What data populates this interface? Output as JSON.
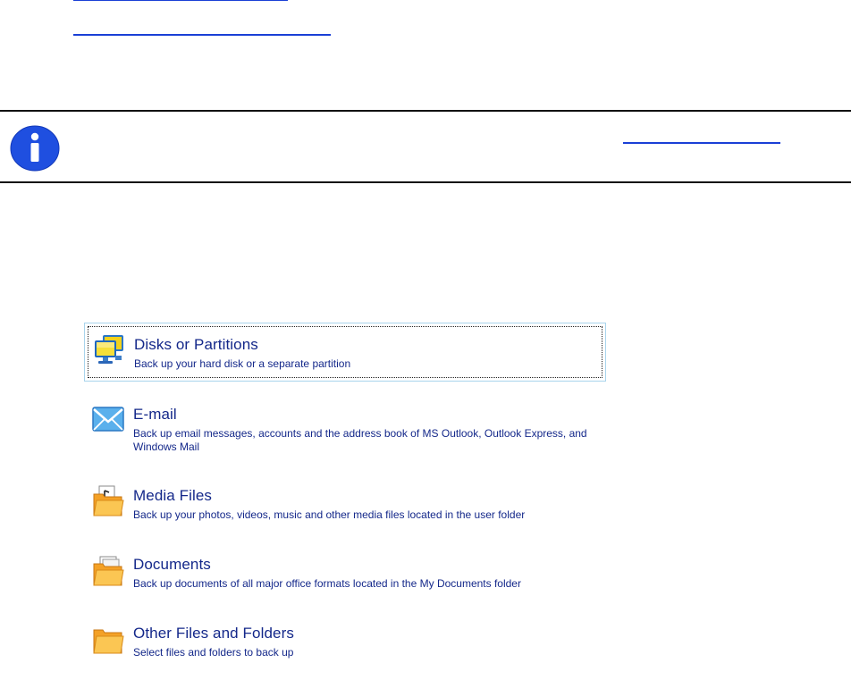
{
  "options": [
    {
      "title": "Disks or Partitions",
      "description": "Back up your hard disk or a separate partition",
      "icon": "monitor-icon",
      "selected": true
    },
    {
      "title": "E-mail",
      "description": "Back up email messages, accounts and the address book of MS Outlook, Outlook Express, and Windows Mail",
      "icon": "envelope-icon",
      "selected": false
    },
    {
      "title": "Media Files",
      "description": "Back up your photos, videos, music and other media files located in the user folder",
      "icon": "media-folder-icon",
      "selected": false
    },
    {
      "title": "Documents",
      "description": "Back up documents of all major office formats located in the My Documents folder",
      "icon": "documents-folder-icon",
      "selected": false
    },
    {
      "title": "Other Files and Folders",
      "description": "Select files and folders to back up",
      "icon": "folder-icon",
      "selected": false
    }
  ],
  "colors": {
    "text": "#14288a",
    "link": "#1a3fd6",
    "info_icon": "#1f4fe0",
    "selection_border": "#a9d4ec"
  }
}
